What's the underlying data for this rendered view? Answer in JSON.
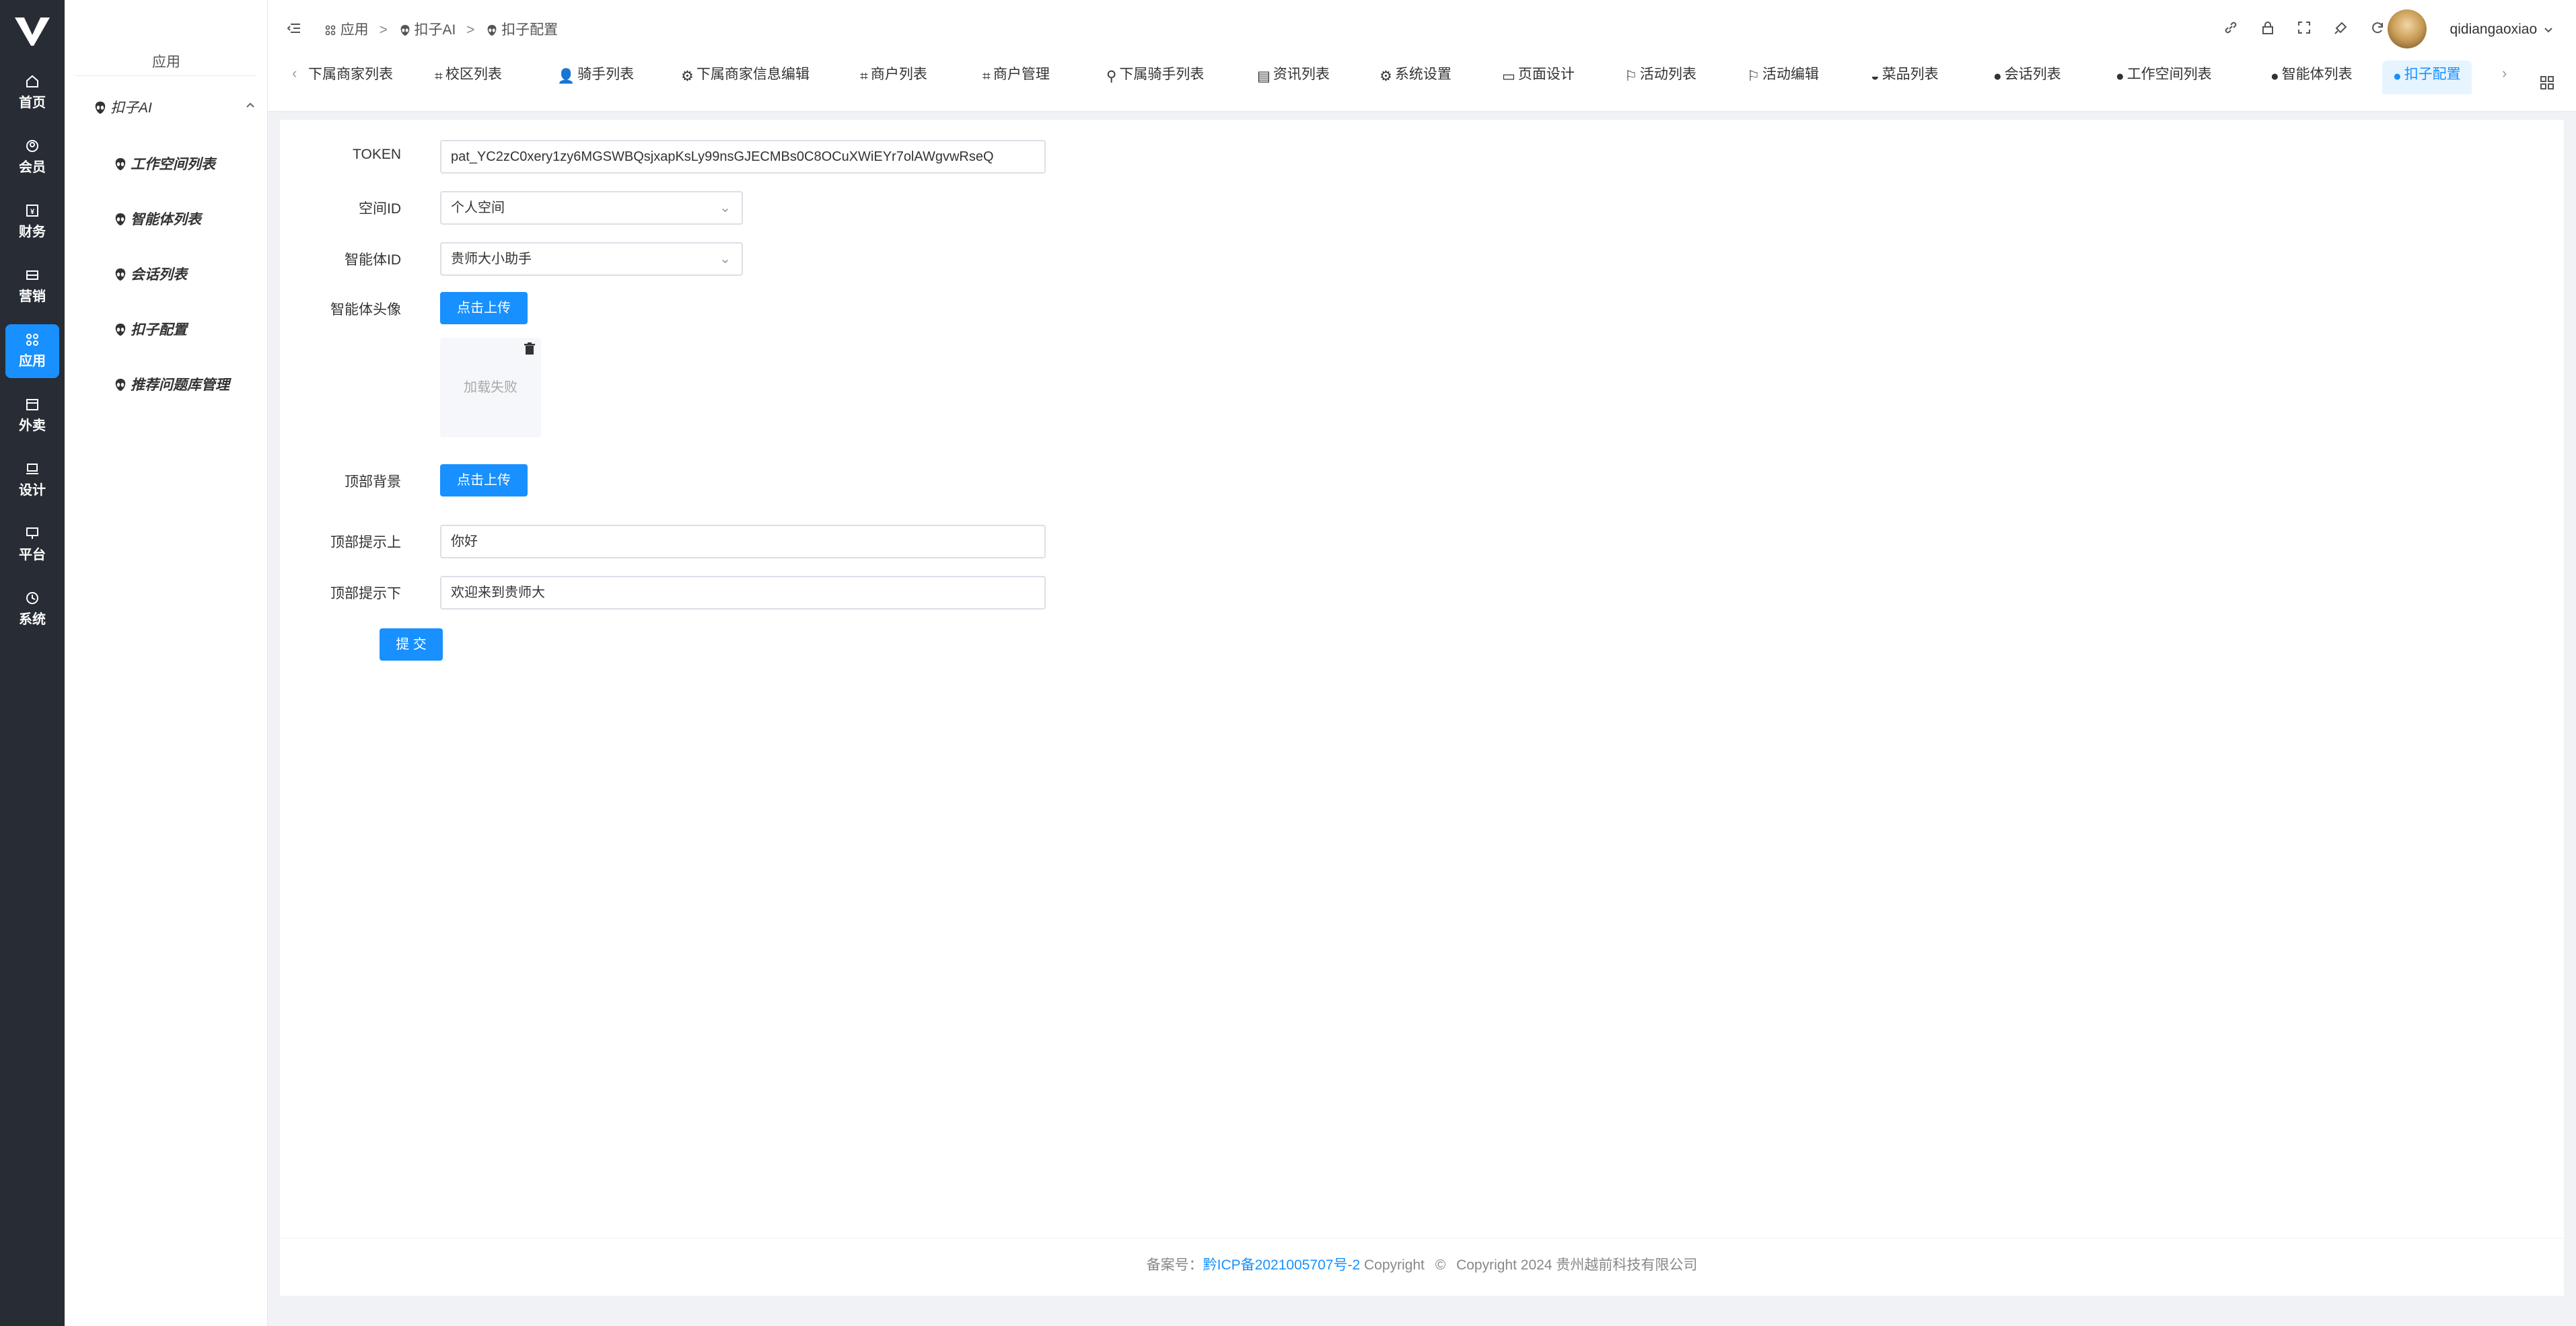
{
  "rail": {
    "items": [
      {
        "label": "首页",
        "icon": "home-icon"
      },
      {
        "label": "会员",
        "icon": "user-icon"
      },
      {
        "label": "财务",
        "icon": "money-icon"
      },
      {
        "label": "营销",
        "icon": "ticket-icon"
      },
      {
        "label": "应用",
        "icon": "apps-icon",
        "active": true
      },
      {
        "label": "外卖",
        "icon": "box-icon"
      },
      {
        "label": "设计",
        "icon": "laptop-icon"
      },
      {
        "label": "平台",
        "icon": "monitor-icon"
      },
      {
        "label": "系统",
        "icon": "clock-icon"
      }
    ]
  },
  "sidebar": {
    "title": "应用",
    "group": "扣子AI",
    "items": [
      "工作空间列表",
      "智能体列表",
      "会话列表",
      "扣子配置",
      "推荐问题库管理"
    ]
  },
  "header": {
    "breadcrumb": [
      "应用",
      "扣子AI",
      "扣子配置"
    ],
    "breadcrumb_sep": ">",
    "username": "qidiangaoxiao"
  },
  "tabs": [
    "下属商家列表",
    "校区列表",
    "骑手列表",
    "下属商家信息编辑",
    "商户列表",
    "商户管理",
    "下属骑手列表",
    "资讯列表",
    "系统设置",
    "页面设计",
    "活动列表",
    "活动编辑",
    "菜品列表",
    "会话列表",
    "工作空间列表",
    "智能体列表",
    "扣子配置"
  ],
  "form": {
    "token_label": "TOKEN",
    "token_value": "pat_YC2zC0xery1zy6MGSWBQsjxapKsLy99nsGJECMBs0C8OCuXWiEYr7olAWgvwRseQ",
    "space_label": "空间ID",
    "space_value": "个人空间",
    "agent_label": "智能体ID",
    "agent_value": "贵师大小助手",
    "avatar_label": "智能体头像",
    "upload_label": "点击上传",
    "load_failed": "加载失败",
    "bg_label": "顶部背景",
    "upload_label_2": "点击上传",
    "top_hint_up_label": "顶部提示上",
    "top_hint_up_value": "你好",
    "top_hint_down_label": "顶部提示下",
    "top_hint_down_value": "欢迎来到贵师大",
    "submit_label": "提 交"
  },
  "footer": {
    "prefix": "备案号：",
    "icp": "黔ICP备2021005707号-2",
    "copyright_word": "Copyright",
    "copyright_text": "Copyright 2024 贵州越前科技有限公司"
  },
  "colors": {
    "accent": "#1890ff",
    "rail_bg": "#282c34"
  }
}
